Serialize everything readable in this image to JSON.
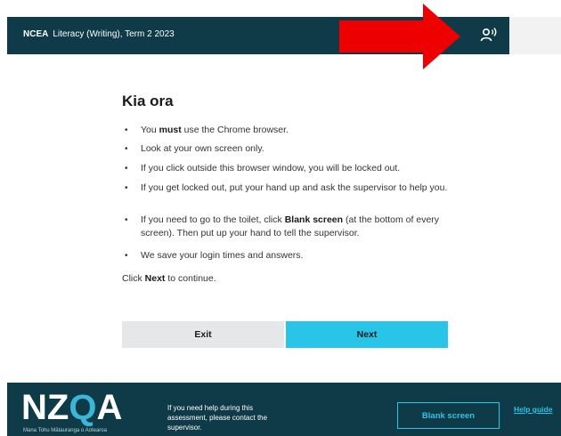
{
  "header": {
    "brand": "NCEA",
    "title": "Literacy (Writing), Term 2 2023",
    "audio_icon": "text-to-speech-icon"
  },
  "annotation": {
    "arrow_color": "#ee0000",
    "arrow_icon": "red-arrow-icon"
  },
  "main": {
    "greeting": "Kia ora",
    "bullets": [
      {
        "pre": "You ",
        "bold": "must",
        "post": " use the Chrome browser."
      },
      {
        "pre": "Look at your own screen only.",
        "bold": "",
        "post": ""
      },
      {
        "pre": "If you click outside this browser window, you will be locked out.",
        "bold": "",
        "post": ""
      },
      {
        "pre": "If you get locked out, put your hand up and ask the supervisor to help you.",
        "bold": "",
        "post": ""
      },
      {
        "pre": "If you need to go to the toilet, click ",
        "bold": "Blank screen",
        "post": " (at the bottom of every screen). Then put up your hand to tell the supervisor."
      },
      {
        "pre": "We save your login times and answers.",
        "bold": "",
        "post": ""
      }
    ],
    "continue": {
      "pre": "Click ",
      "bold": "Next",
      "post": " to continue."
    }
  },
  "buttons": {
    "exit": "Exit",
    "next": "Next"
  },
  "footer": {
    "logo_letters": [
      "NZ",
      "Q",
      "A"
    ],
    "logo_subtitle": "Mana Tohu Mātauranga o Aotearoa",
    "help_text": "If you need help during this assessment, please contact the supervisor.",
    "blank_screen": "Blank screen",
    "help_guide": "Help guide"
  },
  "colors": {
    "header_bg": "#0f3a48",
    "accent": "#29c5e8",
    "exit_bg": "#e6e7e8"
  }
}
